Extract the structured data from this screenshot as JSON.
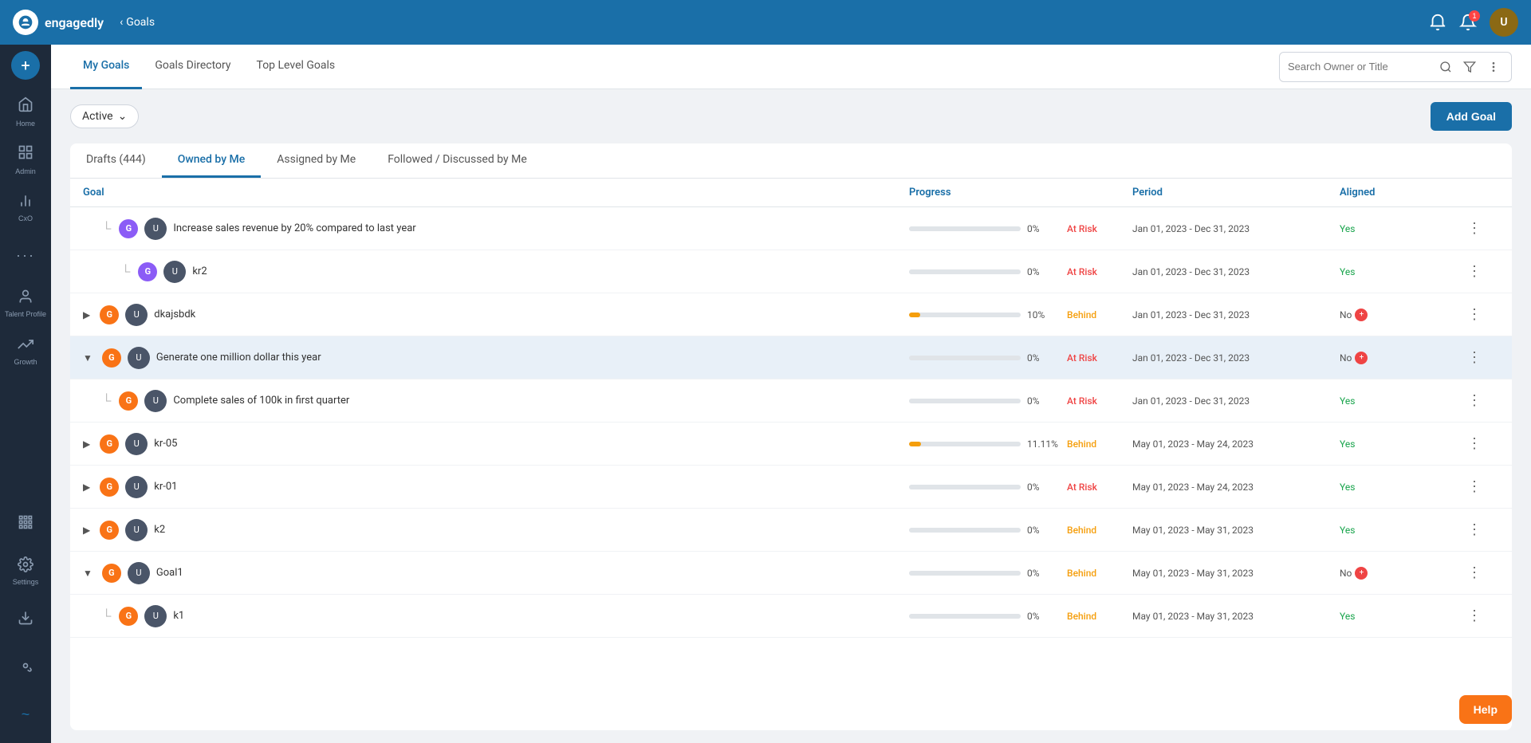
{
  "brand": {
    "name": "engagedly",
    "logo_char": "e"
  },
  "nav": {
    "back_label": "Goals",
    "search_placeholder": "Search Owner or Title"
  },
  "tabs": [
    {
      "id": "my-goals",
      "label": "My Goals",
      "active": true
    },
    {
      "id": "goals-directory",
      "label": "Goals Directory",
      "active": false
    },
    {
      "id": "top-level-goals",
      "label": "Top Level Goals",
      "active": false
    }
  ],
  "filter": {
    "status": "Active",
    "add_goal_label": "Add Goal"
  },
  "sub_tabs": [
    {
      "id": "drafts",
      "label": "Drafts (444)",
      "active": false
    },
    {
      "id": "owned-by-me",
      "label": "Owned by Me",
      "active": true
    },
    {
      "id": "assigned-by-me",
      "label": "Assigned by Me",
      "active": false
    },
    {
      "id": "followed",
      "label": "Followed / Discussed by Me",
      "active": false
    }
  ],
  "table": {
    "headers": [
      "Goal",
      "Progress",
      "Period",
      "Aligned",
      ""
    ],
    "rows": [
      {
        "id": 1,
        "indent": 1,
        "expand": false,
        "icon_color": "purple",
        "icon_char": "G",
        "has_avatar": true,
        "name": "Increase sales revenue by 20% compared to last year",
        "progress_pct": 0,
        "progress_fill": 0,
        "progress_bar_type": "gray",
        "status": "At Risk",
        "status_class": "at-risk",
        "period": "Jan 01, 2023 - Dec 31, 2023",
        "aligned": "Yes",
        "aligned_class": "aligned-yes",
        "has_add": false,
        "highlighted": false
      },
      {
        "id": 2,
        "indent": 2,
        "expand": false,
        "icon_color": "purple",
        "icon_char": "G",
        "has_avatar": true,
        "name": "kr2",
        "progress_pct": 0,
        "progress_fill": 0,
        "progress_bar_type": "gray",
        "status": "At Risk",
        "status_class": "at-risk",
        "period": "Jan 01, 2023 - Dec 31, 2023",
        "aligned": "Yes",
        "aligned_class": "aligned-yes",
        "has_add": false,
        "highlighted": false
      },
      {
        "id": 3,
        "indent": 0,
        "expand": false,
        "icon_color": "orange",
        "icon_char": "G",
        "has_avatar": true,
        "name": "dkajsbdk",
        "progress_pct": 10,
        "progress_fill": 10,
        "progress_bar_type": "yellow",
        "status": "Behind",
        "status_class": "behind",
        "period": "Jan 01, 2023 - Dec 31, 2023",
        "aligned": "No",
        "aligned_class": "aligned-no",
        "has_add": true,
        "highlighted": false
      },
      {
        "id": 4,
        "indent": 0,
        "expand": true,
        "icon_color": "orange",
        "icon_char": "G",
        "has_avatar": true,
        "name": "Generate one million dollar this year",
        "progress_pct": 0,
        "progress_fill": 0,
        "progress_bar_type": "gray",
        "status": "At Risk",
        "status_class": "at-risk",
        "period": "Jan 01, 2023 - Dec 31, 2023",
        "aligned": "No",
        "aligned_class": "aligned-no",
        "has_add": true,
        "highlighted": true
      },
      {
        "id": 5,
        "indent": 1,
        "expand": false,
        "icon_color": "orange",
        "icon_char": "G",
        "has_avatar": true,
        "name": "Complete sales of 100k in first quarter",
        "progress_pct": 0,
        "progress_fill": 0,
        "progress_bar_type": "gray",
        "status": "At Risk",
        "status_class": "at-risk",
        "period": "Jan 01, 2023 - Dec 31, 2023",
        "aligned": "Yes",
        "aligned_class": "aligned-yes",
        "has_add": false,
        "highlighted": false
      },
      {
        "id": 6,
        "indent": 0,
        "expand": false,
        "icon_color": "orange",
        "icon_char": "G",
        "has_avatar": true,
        "name": "kr-05",
        "progress_pct": 11.11,
        "progress_fill": 11,
        "progress_bar_type": "yellow",
        "status": "Behind",
        "status_class": "behind",
        "period": "May 01, 2023 - May 24, 2023",
        "aligned": "Yes",
        "aligned_class": "aligned-yes",
        "has_add": false,
        "highlighted": false
      },
      {
        "id": 7,
        "indent": 0,
        "expand": false,
        "icon_color": "orange",
        "icon_char": "G",
        "has_avatar": true,
        "name": "kr-01",
        "progress_pct": 0,
        "progress_fill": 0,
        "progress_bar_type": "gray",
        "status": "At Risk",
        "status_class": "at-risk",
        "period": "May 01, 2023 - May 24, 2023",
        "aligned": "Yes",
        "aligned_class": "aligned-yes",
        "has_add": false,
        "highlighted": false
      },
      {
        "id": 8,
        "indent": 0,
        "expand": false,
        "icon_color": "orange",
        "icon_char": "G",
        "has_avatar": true,
        "name": "k2",
        "progress_pct": 0,
        "progress_fill": 0,
        "progress_bar_type": "gray",
        "status": "Behind",
        "status_class": "behind",
        "period": "May 01, 2023 - May 31, 2023",
        "aligned": "Yes",
        "aligned_class": "aligned-yes",
        "has_add": false,
        "highlighted": false
      },
      {
        "id": 9,
        "indent": 0,
        "expand": true,
        "icon_color": "orange",
        "icon_char": "G",
        "has_avatar": true,
        "name": "Goal1",
        "progress_pct": 0,
        "progress_fill": 0,
        "progress_bar_type": "gray",
        "status": "Behind",
        "status_class": "behind",
        "period": "May 01, 2023 - May 31, 2023",
        "aligned": "No",
        "aligned_class": "aligned-no",
        "has_add": true,
        "highlighted": false
      },
      {
        "id": 10,
        "indent": 1,
        "expand": false,
        "icon_color": "orange",
        "icon_char": "G",
        "has_avatar": true,
        "name": "k1",
        "progress_pct": 0,
        "progress_fill": 0,
        "progress_bar_type": "gray",
        "status": "Behind",
        "status_class": "behind",
        "period": "May 01, 2023 - May 31, 2023",
        "aligned": "Yes",
        "aligned_class": "aligned-yes",
        "has_add": false,
        "highlighted": false
      }
    ]
  },
  "sidebar": {
    "items": [
      {
        "id": "add",
        "label": "",
        "icon": "+"
      },
      {
        "id": "home",
        "label": "Home",
        "icon": "⌂"
      },
      {
        "id": "admin",
        "label": "Admin",
        "icon": "☰"
      },
      {
        "id": "cxo",
        "label": "CxO",
        "icon": "📊"
      },
      {
        "id": "more",
        "label": "···",
        "icon": "···"
      },
      {
        "id": "talent-profile",
        "label": "Talent Profile",
        "icon": "👤"
      },
      {
        "id": "growth",
        "label": "Growth",
        "icon": "📈"
      },
      {
        "id": "apps",
        "label": "",
        "icon": "⊞"
      },
      {
        "id": "settings",
        "label": "Settings",
        "icon": "⚙"
      },
      {
        "id": "download",
        "label": "",
        "icon": "⬇"
      },
      {
        "id": "gear2",
        "label": "",
        "icon": "⚙"
      }
    ]
  },
  "help": {
    "label": "Help"
  }
}
